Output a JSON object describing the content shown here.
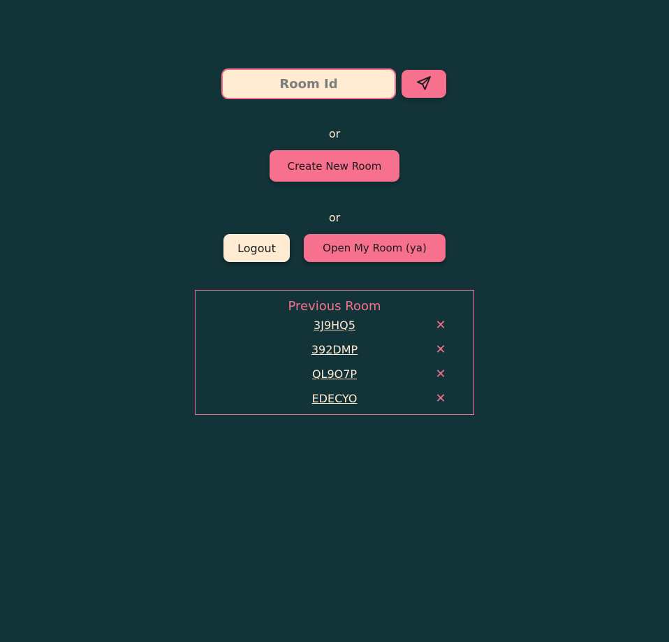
{
  "join": {
    "placeholder": "Room Id",
    "value": "",
    "send_icon": "paper-plane-icon"
  },
  "separator_1": "or",
  "create_button_label": "Create New Room",
  "separator_2": "or",
  "logout_button_label": "Logout",
  "my_room_button_label": "Open My Room (ya)",
  "previous": {
    "title": "Previous Room",
    "remove_icon": "close-icon",
    "remove_glyph": "✕",
    "rooms": [
      {
        "id": "3J9HQ5"
      },
      {
        "id": "392DMP"
      },
      {
        "id": "QL9O7P"
      },
      {
        "id": "EDECYO"
      }
    ]
  },
  "colors": {
    "background": "#123338",
    "accent": "#f7708e",
    "cream": "#ffead2"
  }
}
